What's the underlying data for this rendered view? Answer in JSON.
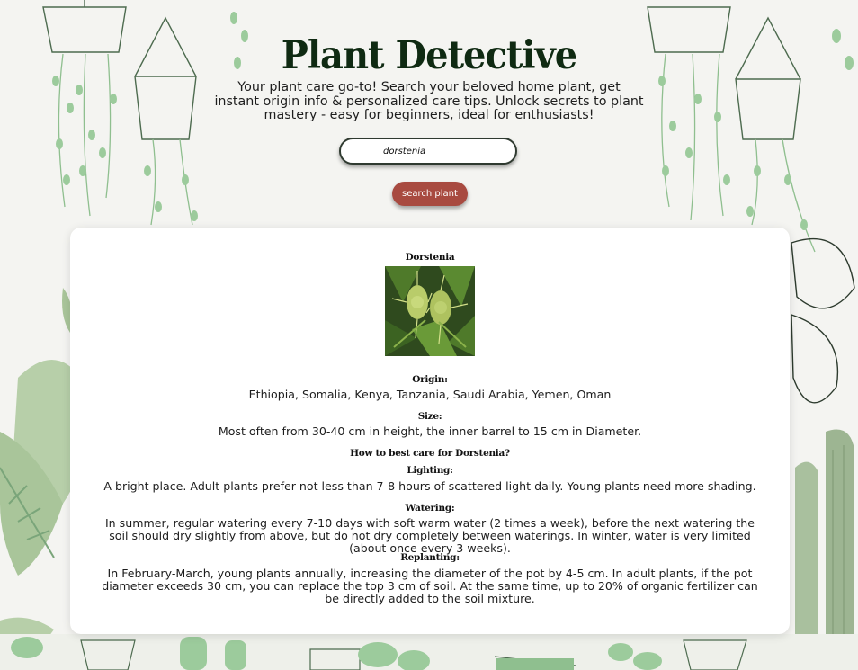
{
  "app": {
    "title": "Plant Detective",
    "subtitle": "Your plant care go-to! Search your beloved home plant, get instant origin info & personalized care tips. Unlock secrets to plant mastery - easy for beginners, ideal for enthusiasts!"
  },
  "search": {
    "value": "dorstenia",
    "button_label": "search plant"
  },
  "colors": {
    "title": "#0f2a12",
    "button": "#a84a40",
    "card": "#ffffff",
    "background": "#f4f4f1",
    "leaf": "#8fbf8f"
  },
  "result": {
    "plant_name": "Dorstenia",
    "origin_label": "Origin:",
    "origin": "Ethiopia, Somalia, Kenya, Tanzania, Saudi Arabia, Yemen, Oman",
    "size_label": "Size:",
    "size": "Most often from 30-40 cm in height, the inner barrel to 15 cm in Diameter.",
    "care_heading": "How to best care for Dorstenia?",
    "lighting_label": "Lighting:",
    "lighting": "A bright place. Adult plants prefer not less than 7-8 hours of scattered light daily. Young plants need more shading.",
    "watering_label": "Watering:",
    "watering": "In summer, regular watering every 7-10 days with soft warm water (2 times a week), before the next watering the soil should dry slightly from above, but do not dry completely between waterings. In winter, water is very limited (about once every 3 weeks).",
    "replanting_label": "Replanting:",
    "replanting": "In February-March, young plants annually, increasing the diameter of the pot by 4-5 cm. In adult plants, if the pot diameter exceeds 30 cm, you can replace the top 3 cm of soil. At the same time, up to 20% of organic fertilizer can be directly added to the soil mixture."
  }
}
